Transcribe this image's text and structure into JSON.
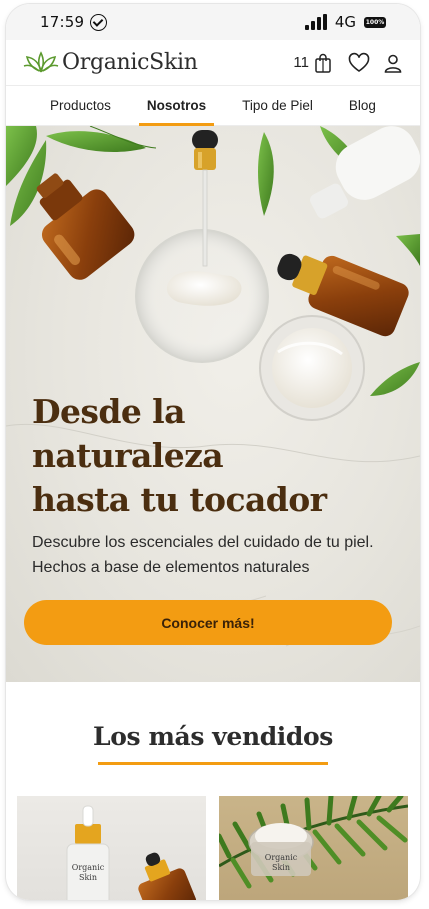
{
  "status_bar": {
    "time": "17:59",
    "network": "4G",
    "battery": "100%"
  },
  "header": {
    "logo_text": "OrganicSkin",
    "cart_count": "11",
    "icons": [
      "cart-bag-icon",
      "heart-icon",
      "user-icon"
    ]
  },
  "nav": {
    "items": [
      {
        "label": "Productos",
        "active": false
      },
      {
        "label": "Nosotros",
        "active": true
      },
      {
        "label": "Tipo de Piel",
        "active": false
      },
      {
        "label": "Blog",
        "active": false
      }
    ]
  },
  "hero": {
    "title_line1": "Desde la",
    "title_line2": "naturaleza",
    "title_line3": "hasta tu tocador",
    "subtitle": "Descubre los escenciales del cuidado de tu piel. Hechos a base de elementos naturales",
    "cta_label": "Conocer más!"
  },
  "best_sellers": {
    "title": "Los más vendidos",
    "cards": [
      {
        "label_line1": "Organic",
        "label_line2": "Skin"
      },
      {
        "label_line1": "Organic",
        "label_line2": "Skin"
      }
    ]
  },
  "colors": {
    "accent": "#f39c12",
    "hero_title": "#4b2e10",
    "leaf_green": "#5c9a2f"
  }
}
